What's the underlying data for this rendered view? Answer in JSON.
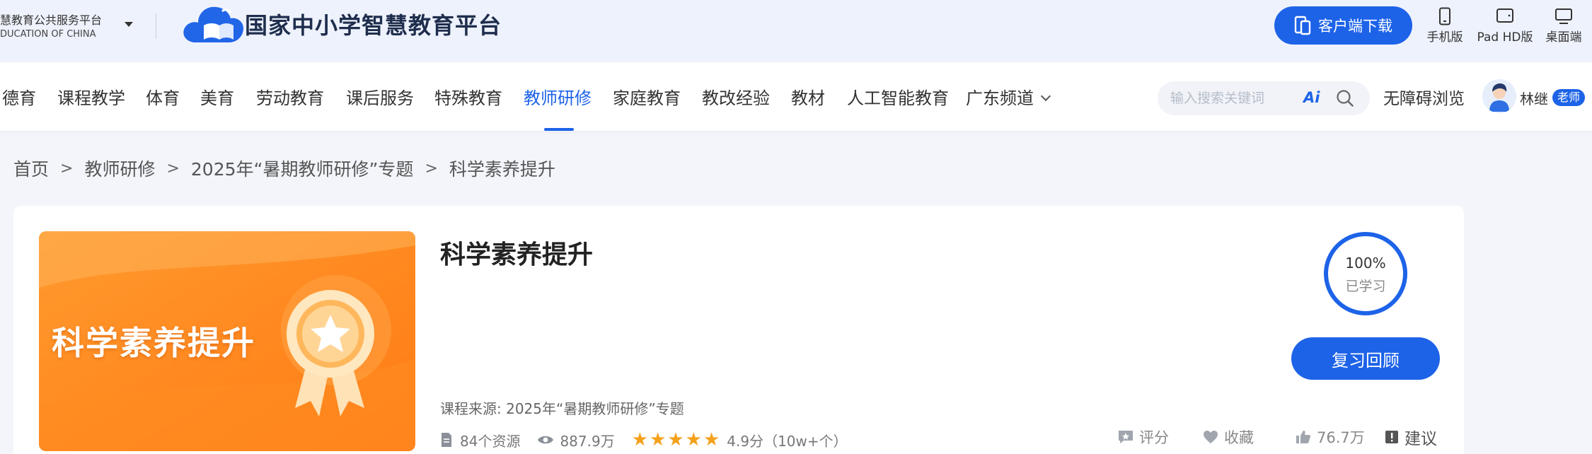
{
  "topbar": {
    "org_name": "慧教育公共服务平台",
    "org_en": "DUCATION OF CHINA",
    "platform_name": "国家中小学智慧教育平台",
    "download_label": "客户端下载",
    "devices": [
      {
        "label": "手机版",
        "icon": "phone-icon"
      },
      {
        "label": "Pad HD版",
        "icon": "tablet-icon"
      },
      {
        "label": "桌面端",
        "icon": "desktop-icon"
      }
    ]
  },
  "nav": {
    "items": [
      {
        "label": "德育"
      },
      {
        "label": "课程教学"
      },
      {
        "label": "体育"
      },
      {
        "label": "美育"
      },
      {
        "label": "劳动教育"
      },
      {
        "label": "课后服务"
      },
      {
        "label": "特殊教育"
      },
      {
        "label": "教师研修",
        "active": true
      },
      {
        "label": "家庭教育"
      },
      {
        "label": "教改经验"
      },
      {
        "label": "教材"
      },
      {
        "label": "人工智能教育"
      },
      {
        "label": "广东频道"
      }
    ],
    "search_placeholder": "输入搜索关键词",
    "ai_label": "Ai",
    "accessibility_label": "无障碍浏览",
    "user_name": "林继",
    "user_role": "老师"
  },
  "breadcrumb": {
    "items": [
      "首页",
      "教师研修",
      "2025年“暑期教师研修”专题",
      "科学素养提升"
    ],
    "separator": ">"
  },
  "course": {
    "cover_text": "科学素养提升",
    "title": "科学素养提升",
    "source_label": "课程来源:",
    "source_value": "2025年“暑期教师研修”专题",
    "resources": "84个资源",
    "views": "887.9万",
    "rating": 4.9,
    "rating_text": "4.9分（10w+个）",
    "progress_percent": "100%",
    "progress_label": "已学习",
    "progress_fraction": 1.0,
    "review_button": "复习回顾",
    "actions": {
      "rate": "评分",
      "favorite": "收藏",
      "likes": "76.7万",
      "suggest": "建议"
    }
  },
  "colors": {
    "accent": "#1d63e8",
    "star": "#f4a11b",
    "cover_orange": "#ff8a1f"
  }
}
